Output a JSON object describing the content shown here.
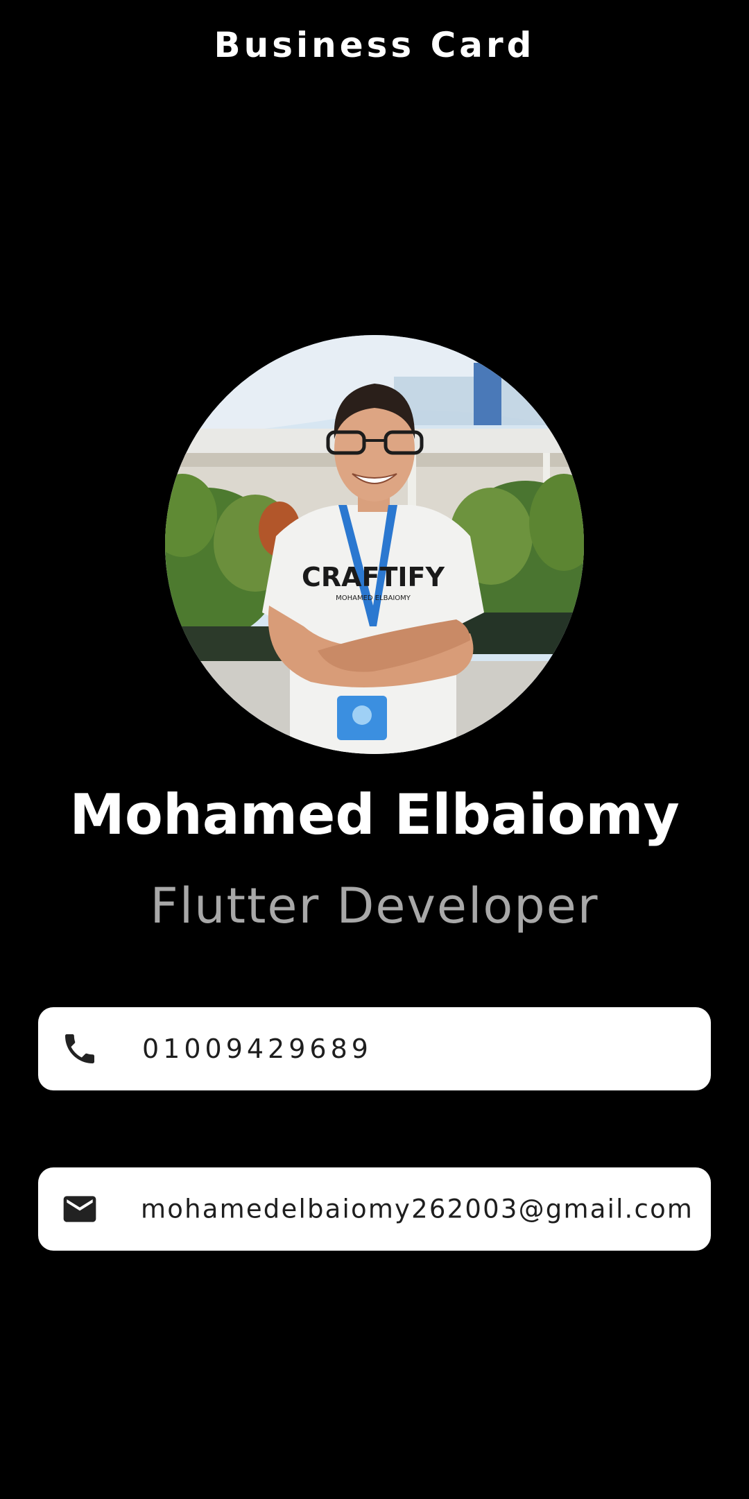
{
  "app_bar": {
    "title": "Business Card"
  },
  "profile": {
    "photo_icon": "profile-photo",
    "name": "Mohamed Elbaiomy",
    "role": "Flutter Developer",
    "shirt_text": "CRAFTIFY",
    "shirt_subtext": "MOHAMED ELBAIOMY"
  },
  "contacts": {
    "phone": {
      "icon": "phone-icon",
      "value": "01009429689"
    },
    "email": {
      "icon": "mail-icon",
      "value": "mohamedelbaiomy262003@gmail.com"
    }
  },
  "colors": {
    "background": "#000000",
    "card": "#ffffff",
    "primary_text": "#ffffff",
    "secondary_text": "#a8a8a8",
    "card_text": "#1e1e1e"
  }
}
